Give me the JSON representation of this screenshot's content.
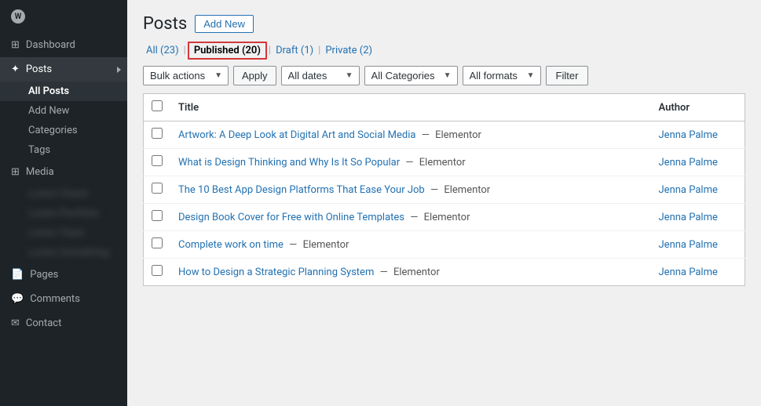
{
  "sidebar": {
    "logo": "W",
    "items": [
      {
        "id": "dashboard",
        "label": "Dashboard",
        "icon": "dashboard-icon"
      },
      {
        "id": "posts",
        "label": "Posts",
        "icon": "posts-icon",
        "active": true,
        "hasArrow": true
      },
      {
        "id": "all-posts",
        "label": "All Posts",
        "sub": true,
        "active": true
      },
      {
        "id": "add-new",
        "label": "Add New",
        "sub": true
      },
      {
        "id": "categories",
        "label": "Categories",
        "sub": true
      },
      {
        "id": "tags",
        "label": "Tags",
        "sub": true
      },
      {
        "id": "media",
        "label": "Media",
        "icon": "media-icon"
      },
      {
        "id": "blurred1",
        "label": "Lorem Check",
        "sub": true,
        "blurred": true
      },
      {
        "id": "blurred2",
        "label": "Lorem Portfolio",
        "sub": true,
        "blurred": true
      },
      {
        "id": "blurred3",
        "label": "Lorem Team",
        "sub": true,
        "blurred": true
      },
      {
        "id": "blurred4",
        "label": "Lorem Something",
        "sub": true,
        "blurred": true
      },
      {
        "id": "pages",
        "label": "Pages",
        "icon": "pages-icon"
      },
      {
        "id": "comments",
        "label": "Comments",
        "icon": "comments-icon"
      },
      {
        "id": "contact",
        "label": "Contact",
        "icon": "contact-icon"
      }
    ]
  },
  "page": {
    "title": "Posts",
    "add_new_label": "Add New"
  },
  "filter_tabs": [
    {
      "id": "all",
      "label": "All",
      "count": "(23)",
      "active": false
    },
    {
      "id": "published",
      "label": "Published",
      "count": "(20)",
      "active": true
    },
    {
      "id": "draft",
      "label": "Draft",
      "count": "(1)",
      "active": false
    },
    {
      "id": "private",
      "label": "Private",
      "count": "(2)",
      "active": false
    }
  ],
  "toolbar": {
    "bulk_actions_label": "Bulk actions",
    "apply_label": "Apply",
    "all_dates_label": "All dates",
    "all_categories_label": "All Categories",
    "all_formats_label": "All formats",
    "filter_label": "Filter"
  },
  "table": {
    "col_title": "Title",
    "col_author": "Author",
    "rows": [
      {
        "title": "Artwork: A Deep Look at Digital Art and Social Media",
        "via": "Elementor",
        "author": "Jenna Palme"
      },
      {
        "title": "What is Design Thinking and Why Is It So Popular",
        "via": "Elementor",
        "author": "Jenna Palme"
      },
      {
        "title": "The 10 Best App Design Platforms That Ease Your Job",
        "via": "Elementor",
        "author": "Jenna Palme"
      },
      {
        "title": "Design Book Cover for Free with Online Templates",
        "via": "Elementor",
        "author": "Jenna Palme"
      },
      {
        "title": "Complete work on time",
        "via": "Elementor",
        "author": "Jenna Palme"
      },
      {
        "title": "How to Design a Strategic Planning System",
        "via": "Elementor",
        "author": "Jenna Palme"
      }
    ]
  }
}
